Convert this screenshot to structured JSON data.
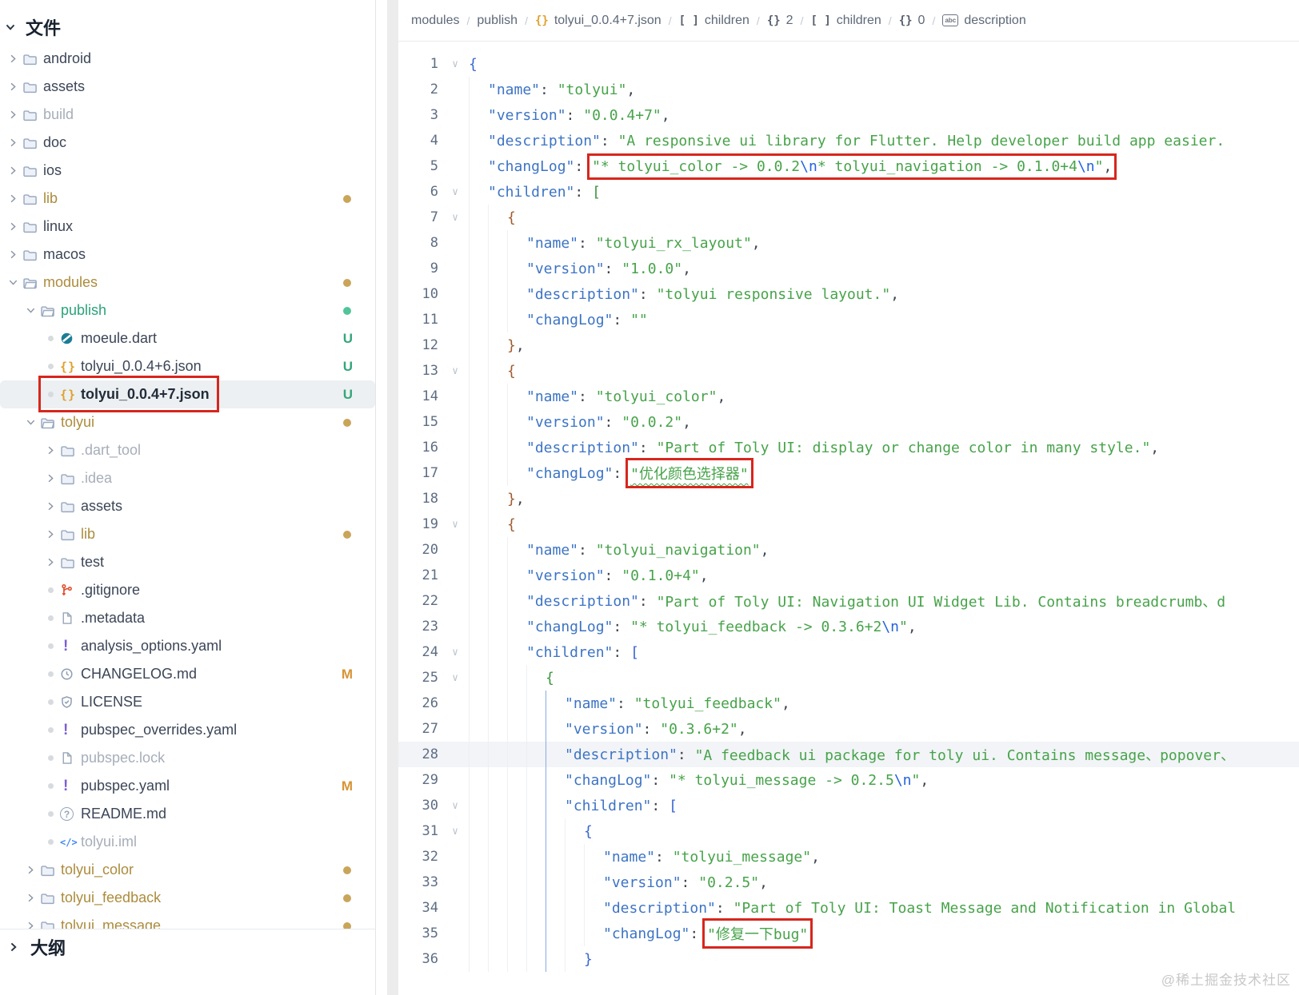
{
  "colors": {
    "annotation_red": "#d7261d",
    "key_blue": "#3d74c4",
    "string_green": "#47a34a",
    "escape_blue": "#2462e0",
    "bracket_blue": "#3a66d0",
    "bracket_green": "#3d9440",
    "bracket_brown": "#a15b2e",
    "badge_added_green": "#35a77c",
    "badge_modified_orange": "#d79435",
    "gold_modified_dir": "#ac8c3d",
    "green_added_dir": "#2ba379",
    "json_icon_orange": "#dfa12f",
    "active_line_bg": "#f2f4f7",
    "selected_row_bg": "#edf0f2"
  },
  "sidebar": {
    "files_header": "文件",
    "outline_header": "大纲",
    "items": [
      {
        "label": "android",
        "depth": 0,
        "lead": "chev-right",
        "icon": "folder",
        "color": "normal"
      },
      {
        "label": "assets",
        "depth": 0,
        "lead": "chev-right",
        "icon": "folder",
        "color": "normal"
      },
      {
        "label": "build",
        "depth": 0,
        "lead": "chev-right",
        "icon": "folder",
        "color": "dim"
      },
      {
        "label": "doc",
        "depth": 0,
        "lead": "chev-right",
        "icon": "folder",
        "color": "normal"
      },
      {
        "label": "ios",
        "depth": 0,
        "lead": "chev-right",
        "icon": "folder",
        "color": "normal"
      },
      {
        "label": "lib",
        "depth": 0,
        "lead": "chev-right",
        "icon": "folder",
        "color": "gold",
        "dot": "gold"
      },
      {
        "label": "linux",
        "depth": 0,
        "lead": "chev-right",
        "icon": "folder",
        "color": "normal"
      },
      {
        "label": "macos",
        "depth": 0,
        "lead": "chev-right",
        "icon": "folder",
        "color": "normal"
      },
      {
        "label": "modules",
        "depth": 0,
        "lead": "chev-down",
        "icon": "folder-open",
        "color": "gold",
        "dot": "gold"
      },
      {
        "label": "publish",
        "depth": 1,
        "lead": "chev-down",
        "icon": "folder-open",
        "color": "green",
        "dot": "green"
      },
      {
        "label": "moeule.dart",
        "depth": 2,
        "lead": "bullet",
        "icon": "dart",
        "color": "normal",
        "badge": "U"
      },
      {
        "label": "tolyui_0.0.4+6.json",
        "depth": 2,
        "lead": "bullet",
        "icon": "json",
        "color": "normal",
        "badge": "U"
      },
      {
        "label": "tolyui_0.0.4+7.json",
        "depth": 2,
        "lead": "bullet",
        "icon": "json",
        "color": "normal",
        "badge": "U",
        "bold": true,
        "selected": true,
        "annotated": true
      },
      {
        "label": "tolyui",
        "depth": 1,
        "lead": "chev-down",
        "icon": "folder-open",
        "color": "gold",
        "dot": "gold"
      },
      {
        "label": ".dart_tool",
        "depth": 2,
        "lead": "chev-right",
        "icon": "folder",
        "color": "dim"
      },
      {
        "label": ".idea",
        "depth": 2,
        "lead": "chev-right",
        "icon": "folder",
        "color": "dim"
      },
      {
        "label": "assets",
        "depth": 2,
        "lead": "chev-right",
        "icon": "folder",
        "color": "normal"
      },
      {
        "label": "lib",
        "depth": 2,
        "lead": "chev-right",
        "icon": "folder",
        "color": "gold",
        "dot": "gold"
      },
      {
        "label": "test",
        "depth": 2,
        "lead": "chev-right",
        "icon": "folder",
        "color": "normal"
      },
      {
        "label": ".gitignore",
        "depth": 2,
        "lead": "bullet",
        "icon": "git",
        "color": "normal"
      },
      {
        "label": ".metadata",
        "depth": 2,
        "lead": "bullet",
        "icon": "file",
        "color": "normal"
      },
      {
        "label": "analysis_options.yaml",
        "depth": 2,
        "lead": "bullet",
        "icon": "excl",
        "color": "normal"
      },
      {
        "label": "CHANGELOG.md",
        "depth": 2,
        "lead": "bullet",
        "icon": "clock",
        "color": "normal",
        "badge": "M"
      },
      {
        "label": "LICENSE",
        "depth": 2,
        "lead": "bullet",
        "icon": "shield",
        "color": "normal"
      },
      {
        "label": "pubspec_overrides.yaml",
        "depth": 2,
        "lead": "bullet",
        "icon": "excl",
        "color": "normal"
      },
      {
        "label": "pubspec.lock",
        "depth": 2,
        "lead": "bullet",
        "icon": "file",
        "color": "dim"
      },
      {
        "label": "pubspec.yaml",
        "depth": 2,
        "lead": "bullet",
        "icon": "excl",
        "color": "normal",
        "badge": "M"
      },
      {
        "label": "README.md",
        "depth": 2,
        "lead": "bullet",
        "icon": "help",
        "color": "normal"
      },
      {
        "label": "tolyui.iml",
        "depth": 2,
        "lead": "bullet",
        "icon": "code",
        "color": "dim"
      },
      {
        "label": "tolyui_color",
        "depth": 1,
        "lead": "chev-right",
        "icon": "folder",
        "color": "gold",
        "dot": "gold"
      },
      {
        "label": "tolyui_feedback",
        "depth": 1,
        "lead": "chev-right",
        "icon": "folder",
        "color": "gold",
        "dot": "gold"
      },
      {
        "label": "tolyui_message",
        "depth": 1,
        "lead": "chev-right",
        "icon": "folder",
        "color": "gold",
        "dot": "gold"
      }
    ]
  },
  "breadcrumb": [
    {
      "label": "modules"
    },
    {
      "label": "publish"
    },
    {
      "icon": "braces-orange",
      "label": "tolyui_0.0.4+7.json"
    },
    {
      "icon": "brackets",
      "label": "children"
    },
    {
      "icon": "braces",
      "label": "2"
    },
    {
      "icon": "brackets",
      "label": "children"
    },
    {
      "icon": "braces",
      "label": "0"
    },
    {
      "icon": "abc",
      "label": "description"
    }
  ],
  "editor": {
    "lines": [
      {
        "n": 1,
        "ind": 0,
        "fold": true,
        "tokens": [
          [
            "bb",
            "{"
          ]
        ]
      },
      {
        "n": 2,
        "ind": 1,
        "tokens": [
          [
            "k",
            "\"name\""
          ],
          [
            "p",
            ": "
          ],
          [
            "s",
            "\"tolyui\""
          ],
          [
            "p",
            ","
          ]
        ]
      },
      {
        "n": 3,
        "ind": 1,
        "tokens": [
          [
            "k",
            "\"version\""
          ],
          [
            "p",
            ": "
          ],
          [
            "s",
            "\"0.0.4+7\""
          ],
          [
            "p",
            ","
          ]
        ]
      },
      {
        "n": 4,
        "ind": 1,
        "tokens": [
          [
            "k",
            "\"description\""
          ],
          [
            "p",
            ": "
          ],
          [
            "s",
            "\"A responsive ui library for Flutter. Help developer build app easier."
          ]
        ]
      },
      {
        "n": 5,
        "ind": 1,
        "box": [
          2,
          7
        ],
        "tokens": [
          [
            "k",
            "\"changLog\""
          ],
          [
            "p",
            ": "
          ],
          [
            "s",
            "\"* tolyui_color -> 0.0.2"
          ],
          [
            "e",
            "\\n"
          ],
          [
            "s",
            "* tolyui_navigation -> 0.1.0+4"
          ],
          [
            "e",
            "\\n"
          ],
          [
            "s",
            "\""
          ],
          [
            "p",
            ","
          ]
        ]
      },
      {
        "n": 6,
        "ind": 1,
        "fold": true,
        "tokens": [
          [
            "k",
            "\"children\""
          ],
          [
            "p",
            ": "
          ],
          [
            "bg",
            "["
          ]
        ]
      },
      {
        "n": 7,
        "ind": 2,
        "fold": true,
        "tokens": [
          [
            "bn",
            "{"
          ]
        ]
      },
      {
        "n": 8,
        "ind": 3,
        "tokens": [
          [
            "k",
            "\"name\""
          ],
          [
            "p",
            ": "
          ],
          [
            "s",
            "\"tolyui_rx_layout\""
          ],
          [
            "p",
            ","
          ]
        ]
      },
      {
        "n": 9,
        "ind": 3,
        "tokens": [
          [
            "k",
            "\"version\""
          ],
          [
            "p",
            ": "
          ],
          [
            "s",
            "\"1.0.0\""
          ],
          [
            "p",
            ","
          ]
        ]
      },
      {
        "n": 10,
        "ind": 3,
        "tokens": [
          [
            "k",
            "\"description\""
          ],
          [
            "p",
            ": "
          ],
          [
            "s",
            "\"tolyui responsive layout.\""
          ],
          [
            "p",
            ","
          ]
        ]
      },
      {
        "n": 11,
        "ind": 3,
        "tokens": [
          [
            "k",
            "\"changLog\""
          ],
          [
            "p",
            ": "
          ],
          [
            "s",
            "\"\""
          ]
        ]
      },
      {
        "n": 12,
        "ind": 2,
        "tokens": [
          [
            "bn",
            "}"
          ],
          [
            "p",
            ","
          ]
        ]
      },
      {
        "n": 13,
        "ind": 2,
        "fold": true,
        "tokens": [
          [
            "bn",
            "{"
          ]
        ]
      },
      {
        "n": 14,
        "ind": 3,
        "tokens": [
          [
            "k",
            "\"name\""
          ],
          [
            "p",
            ": "
          ],
          [
            "s",
            "\"tolyui_color\""
          ],
          [
            "p",
            ","
          ]
        ]
      },
      {
        "n": 15,
        "ind": 3,
        "tokens": [
          [
            "k",
            "\"version\""
          ],
          [
            "p",
            ": "
          ],
          [
            "s",
            "\"0.0.2\""
          ],
          [
            "p",
            ","
          ]
        ]
      },
      {
        "n": 16,
        "ind": 3,
        "tokens": [
          [
            "k",
            "\"description\""
          ],
          [
            "p",
            ": "
          ],
          [
            "s",
            "\"Part of Toly UI: display or change color in many style.\""
          ],
          [
            "p",
            ","
          ]
        ]
      },
      {
        "n": 17,
        "ind": 3,
        "box": [
          2,
          2
        ],
        "tokens": [
          [
            "k",
            "\"changLog\""
          ],
          [
            "p",
            ": "
          ],
          [
            "su",
            "\"优化颜色选择器\""
          ]
        ]
      },
      {
        "n": 18,
        "ind": 2,
        "tokens": [
          [
            "bn",
            "}"
          ],
          [
            "p",
            ","
          ]
        ]
      },
      {
        "n": 19,
        "ind": 2,
        "fold": true,
        "tokens": [
          [
            "bn",
            "{"
          ]
        ]
      },
      {
        "n": 20,
        "ind": 3,
        "tokens": [
          [
            "k",
            "\"name\""
          ],
          [
            "p",
            ": "
          ],
          [
            "s",
            "\"tolyui_navigation\""
          ],
          [
            "p",
            ","
          ]
        ]
      },
      {
        "n": 21,
        "ind": 3,
        "tokens": [
          [
            "k",
            "\"version\""
          ],
          [
            "p",
            ": "
          ],
          [
            "s",
            "\"0.1.0+4\""
          ],
          [
            "p",
            ","
          ]
        ]
      },
      {
        "n": 22,
        "ind": 3,
        "tokens": [
          [
            "k",
            "\"description\""
          ],
          [
            "p",
            ": "
          ],
          [
            "s",
            "\"Part of Toly UI: Navigation UI Widget Lib. Contains breadcrumb、d"
          ]
        ]
      },
      {
        "n": 23,
        "ind": 3,
        "tokens": [
          [
            "k",
            "\"changLog\""
          ],
          [
            "p",
            ": "
          ],
          [
            "s",
            "\"* tolyui_feedback -> 0.3.6+2"
          ],
          [
            "e",
            "\\n"
          ],
          [
            "s",
            "\""
          ],
          [
            "p",
            ","
          ]
        ]
      },
      {
        "n": 24,
        "ind": 3,
        "fold": true,
        "tokens": [
          [
            "k",
            "\"children\""
          ],
          [
            "p",
            ": "
          ],
          [
            "bb",
            "["
          ]
        ]
      },
      {
        "n": 25,
        "ind": 4,
        "fold": true,
        "tokens": [
          [
            "bg",
            "{"
          ]
        ]
      },
      {
        "n": 26,
        "ind": 5,
        "guide": true,
        "tokens": [
          [
            "k",
            "\"name\""
          ],
          [
            "p",
            ": "
          ],
          [
            "s",
            "\"tolyui_feedback\""
          ],
          [
            "p",
            ","
          ]
        ]
      },
      {
        "n": 27,
        "ind": 5,
        "guide": true,
        "tokens": [
          [
            "k",
            "\"version\""
          ],
          [
            "p",
            ": "
          ],
          [
            "s",
            "\"0.3.6+2\""
          ],
          [
            "p",
            ","
          ]
        ]
      },
      {
        "n": 28,
        "ind": 5,
        "guide": true,
        "active": true,
        "tokens": [
          [
            "k",
            "\"description\""
          ],
          [
            "p",
            ": "
          ],
          [
            "s",
            "\"A feedback ui package for toly ui. Contains message、popover、"
          ]
        ]
      },
      {
        "n": 29,
        "ind": 5,
        "guide": true,
        "tokens": [
          [
            "k",
            "\"changLog\""
          ],
          [
            "p",
            ": "
          ],
          [
            "s",
            "\"* tolyui_message -> 0.2.5"
          ],
          [
            "e",
            "\\n"
          ],
          [
            "s",
            "\""
          ],
          [
            "p",
            ","
          ]
        ]
      },
      {
        "n": 30,
        "ind": 5,
        "guide": true,
        "fold": true,
        "tokens": [
          [
            "k",
            "\"children\""
          ],
          [
            "p",
            ": "
          ],
          [
            "bb",
            "["
          ]
        ]
      },
      {
        "n": 31,
        "ind": 6,
        "guide": true,
        "fold": true,
        "tokens": [
          [
            "bb",
            "{"
          ]
        ]
      },
      {
        "n": 32,
        "ind": 7,
        "guide": true,
        "tokens": [
          [
            "k",
            "\"name\""
          ],
          [
            "p",
            ": "
          ],
          [
            "s",
            "\"tolyui_message\""
          ],
          [
            "p",
            ","
          ]
        ]
      },
      {
        "n": 33,
        "ind": 7,
        "guide": true,
        "tokens": [
          [
            "k",
            "\"version\""
          ],
          [
            "p",
            ": "
          ],
          [
            "s",
            "\"0.2.5\""
          ],
          [
            "p",
            ","
          ]
        ]
      },
      {
        "n": 34,
        "ind": 7,
        "guide": true,
        "tokens": [
          [
            "k",
            "\"description\""
          ],
          [
            "p",
            ": "
          ],
          [
            "s",
            "\"Part of Toly UI: Toast Message and Notification in Global"
          ]
        ]
      },
      {
        "n": 35,
        "ind": 7,
        "guide": true,
        "box": [
          2,
          2
        ],
        "tokens": [
          [
            "k",
            "\"changLog\""
          ],
          [
            "p",
            ": "
          ],
          [
            "s",
            "\"修复一下bug\""
          ]
        ]
      },
      {
        "n": 36,
        "ind": 6,
        "guide": true,
        "tokens": [
          [
            "bb",
            "}"
          ]
        ]
      }
    ]
  },
  "watermark": "@稀土掘金技术社区"
}
